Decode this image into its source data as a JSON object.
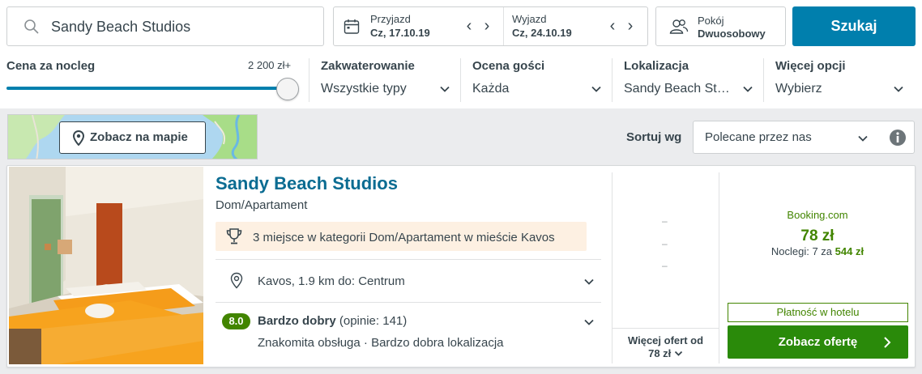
{
  "search": {
    "value": "Sandy Beach Studios"
  },
  "checkin": {
    "label": "Przyjazd",
    "date": "Cz, 17.10.19"
  },
  "checkout": {
    "label": "Wyjazd",
    "date": "Cz, 24.10.19"
  },
  "room": {
    "label": "Pokój",
    "value": "Dwuosobowy"
  },
  "search_button": "Szukaj",
  "filters": {
    "price": {
      "title": "Cena za nocleg",
      "max_label": "2 200 zł+",
      "level_fraction": 1.0
    },
    "accommodation": {
      "title": "Zakwaterowanie",
      "value": "Wszystkie typy"
    },
    "rating": {
      "title": "Ocena gości",
      "value": "Każda"
    },
    "location": {
      "title": "Lokalizacja",
      "value": "Sandy Beach St…"
    },
    "more": {
      "title": "Więcej opcji",
      "value": "Wybierz"
    }
  },
  "map_button": "Zobacz na mapie",
  "sort": {
    "label": "Sortuj wg",
    "value": "Polecane przez nas"
  },
  "result": {
    "name": "Sandy Beach Studios",
    "type": "Dom/Apartament",
    "award": "3 miejsce w kategorii Dom/Apartament w mieście Kavos",
    "location": "Kavos, 1.9 km do: Centrum",
    "rating_score": "8.0",
    "rating_word": "Bardzo dobry",
    "rating_count": "(opinie: 141)",
    "rating_highlights": "Znakomita obsługa · Bardzo dobra lokalizacja",
    "dashes": [
      "–",
      "–",
      "–"
    ],
    "more_offers": {
      "line1": "Więcej ofert od",
      "line2": "78 zł"
    },
    "provider": "Booking.com",
    "price": "78 zł",
    "nights_prefix": "Noclegi: 7 za",
    "nights_total": "544 zł",
    "payment_badge": "Płatność w hotelu",
    "deal_button": "Zobacz ofertę"
  },
  "colors": {
    "accent": "#007fad",
    "green": "#428500",
    "title_blue": "#0b6c92"
  }
}
